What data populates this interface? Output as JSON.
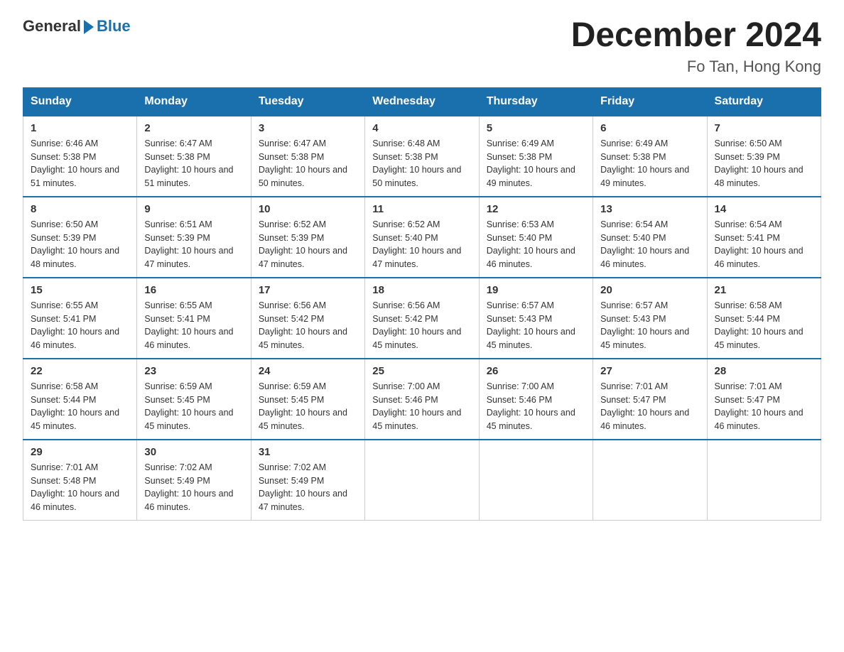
{
  "header": {
    "logo_general": "General",
    "logo_blue": "Blue",
    "month_title": "December 2024",
    "location": "Fo Tan, Hong Kong"
  },
  "weekdays": [
    "Sunday",
    "Monday",
    "Tuesday",
    "Wednesday",
    "Thursday",
    "Friday",
    "Saturday"
  ],
  "weeks": [
    [
      {
        "day": "1",
        "sunrise": "6:46 AM",
        "sunset": "5:38 PM",
        "daylight": "10 hours and 51 minutes."
      },
      {
        "day": "2",
        "sunrise": "6:47 AM",
        "sunset": "5:38 PM",
        "daylight": "10 hours and 51 minutes."
      },
      {
        "day": "3",
        "sunrise": "6:47 AM",
        "sunset": "5:38 PM",
        "daylight": "10 hours and 50 minutes."
      },
      {
        "day": "4",
        "sunrise": "6:48 AM",
        "sunset": "5:38 PM",
        "daylight": "10 hours and 50 minutes."
      },
      {
        "day": "5",
        "sunrise": "6:49 AM",
        "sunset": "5:38 PM",
        "daylight": "10 hours and 49 minutes."
      },
      {
        "day": "6",
        "sunrise": "6:49 AM",
        "sunset": "5:38 PM",
        "daylight": "10 hours and 49 minutes."
      },
      {
        "day": "7",
        "sunrise": "6:50 AM",
        "sunset": "5:39 PM",
        "daylight": "10 hours and 48 minutes."
      }
    ],
    [
      {
        "day": "8",
        "sunrise": "6:50 AM",
        "sunset": "5:39 PM",
        "daylight": "10 hours and 48 minutes."
      },
      {
        "day": "9",
        "sunrise": "6:51 AM",
        "sunset": "5:39 PM",
        "daylight": "10 hours and 47 minutes."
      },
      {
        "day": "10",
        "sunrise": "6:52 AM",
        "sunset": "5:39 PM",
        "daylight": "10 hours and 47 minutes."
      },
      {
        "day": "11",
        "sunrise": "6:52 AM",
        "sunset": "5:40 PM",
        "daylight": "10 hours and 47 minutes."
      },
      {
        "day": "12",
        "sunrise": "6:53 AM",
        "sunset": "5:40 PM",
        "daylight": "10 hours and 46 minutes."
      },
      {
        "day": "13",
        "sunrise": "6:54 AM",
        "sunset": "5:40 PM",
        "daylight": "10 hours and 46 minutes."
      },
      {
        "day": "14",
        "sunrise": "6:54 AM",
        "sunset": "5:41 PM",
        "daylight": "10 hours and 46 minutes."
      }
    ],
    [
      {
        "day": "15",
        "sunrise": "6:55 AM",
        "sunset": "5:41 PM",
        "daylight": "10 hours and 46 minutes."
      },
      {
        "day": "16",
        "sunrise": "6:55 AM",
        "sunset": "5:41 PM",
        "daylight": "10 hours and 46 minutes."
      },
      {
        "day": "17",
        "sunrise": "6:56 AM",
        "sunset": "5:42 PM",
        "daylight": "10 hours and 45 minutes."
      },
      {
        "day": "18",
        "sunrise": "6:56 AM",
        "sunset": "5:42 PM",
        "daylight": "10 hours and 45 minutes."
      },
      {
        "day": "19",
        "sunrise": "6:57 AM",
        "sunset": "5:43 PM",
        "daylight": "10 hours and 45 minutes."
      },
      {
        "day": "20",
        "sunrise": "6:57 AM",
        "sunset": "5:43 PM",
        "daylight": "10 hours and 45 minutes."
      },
      {
        "day": "21",
        "sunrise": "6:58 AM",
        "sunset": "5:44 PM",
        "daylight": "10 hours and 45 minutes."
      }
    ],
    [
      {
        "day": "22",
        "sunrise": "6:58 AM",
        "sunset": "5:44 PM",
        "daylight": "10 hours and 45 minutes."
      },
      {
        "day": "23",
        "sunrise": "6:59 AM",
        "sunset": "5:45 PM",
        "daylight": "10 hours and 45 minutes."
      },
      {
        "day": "24",
        "sunrise": "6:59 AM",
        "sunset": "5:45 PM",
        "daylight": "10 hours and 45 minutes."
      },
      {
        "day": "25",
        "sunrise": "7:00 AM",
        "sunset": "5:46 PM",
        "daylight": "10 hours and 45 minutes."
      },
      {
        "day": "26",
        "sunrise": "7:00 AM",
        "sunset": "5:46 PM",
        "daylight": "10 hours and 45 minutes."
      },
      {
        "day": "27",
        "sunrise": "7:01 AM",
        "sunset": "5:47 PM",
        "daylight": "10 hours and 46 minutes."
      },
      {
        "day": "28",
        "sunrise": "7:01 AM",
        "sunset": "5:47 PM",
        "daylight": "10 hours and 46 minutes."
      }
    ],
    [
      {
        "day": "29",
        "sunrise": "7:01 AM",
        "sunset": "5:48 PM",
        "daylight": "10 hours and 46 minutes."
      },
      {
        "day": "30",
        "sunrise": "7:02 AM",
        "sunset": "5:49 PM",
        "daylight": "10 hours and 46 minutes."
      },
      {
        "day": "31",
        "sunrise": "7:02 AM",
        "sunset": "5:49 PM",
        "daylight": "10 hours and 47 minutes."
      },
      null,
      null,
      null,
      null
    ]
  ]
}
